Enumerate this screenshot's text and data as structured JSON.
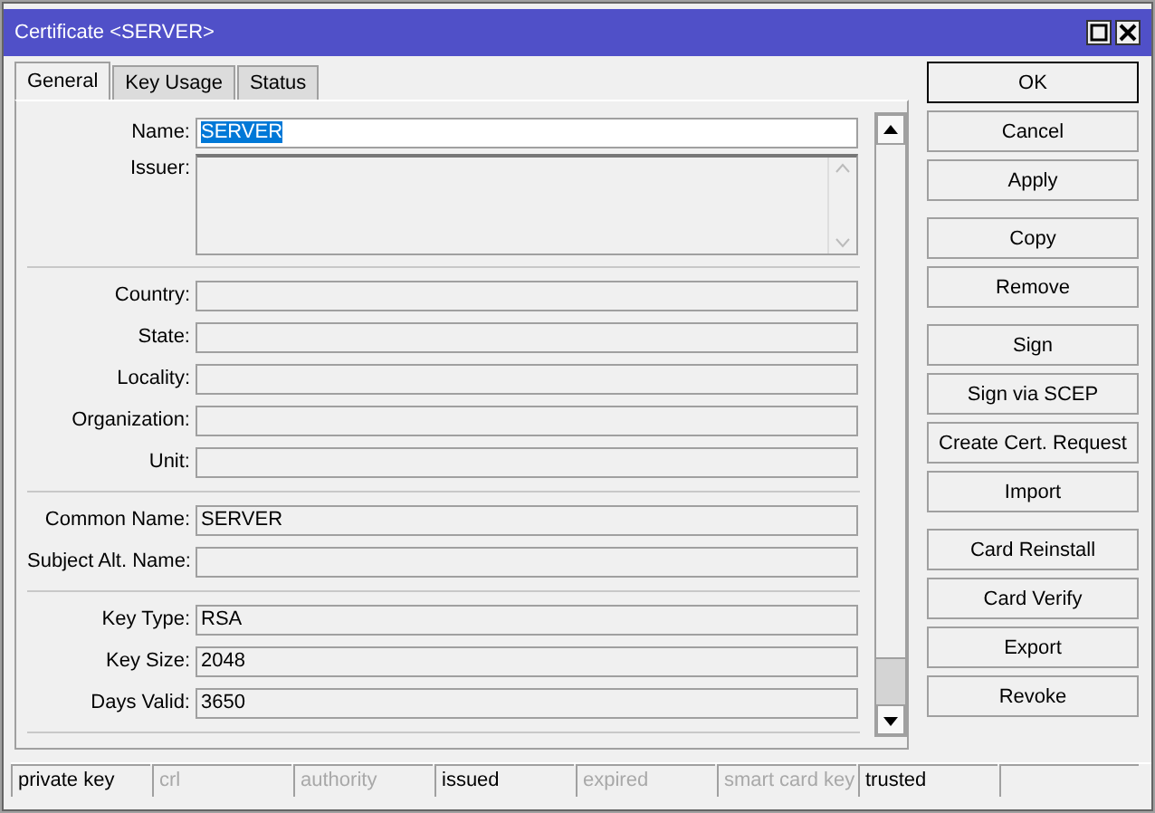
{
  "window": {
    "title": "Certificate <SERVER>"
  },
  "tabs": [
    {
      "label": "General",
      "selected": true
    },
    {
      "label": "Key Usage",
      "selected": false
    },
    {
      "label": "Status",
      "selected": false
    }
  ],
  "sections": [
    [
      {
        "label": "Name:",
        "kind": "input",
        "value": "SERVER",
        "highlighted": true
      },
      {
        "label": "Issuer:",
        "kind": "textarea"
      }
    ],
    [
      {
        "label": "Country:",
        "kind": "readonly"
      },
      {
        "label": "State:",
        "kind": "readonly"
      },
      {
        "label": "Locality:",
        "kind": "readonly"
      },
      {
        "label": "Organization:",
        "kind": "readonly"
      },
      {
        "label": "Unit:",
        "kind": "readonly"
      }
    ],
    [
      {
        "label": "Common Name:",
        "kind": "readonly",
        "value": "SERVER"
      },
      {
        "label": "Subject Alt. Name:",
        "kind": "readonly"
      }
    ],
    [
      {
        "label": "Key Type:",
        "kind": "readonly",
        "value": "RSA"
      },
      {
        "label": "Key Size:",
        "kind": "readonly",
        "value": "2048"
      },
      {
        "label": "Days Valid:",
        "kind": "readonly",
        "value": "3650"
      }
    ]
  ],
  "button_groups": [
    [
      {
        "label": "OK",
        "default": true
      },
      {
        "label": "Cancel",
        "default": false
      },
      {
        "label": "Apply",
        "default": false
      }
    ],
    [
      {
        "label": "Copy",
        "default": false
      },
      {
        "label": "Remove",
        "default": false
      }
    ],
    [
      {
        "label": "Sign",
        "default": false
      },
      {
        "label": "Sign via SCEP",
        "default": false
      },
      {
        "label": "Create Cert. Request",
        "default": false
      },
      {
        "label": "Import",
        "default": false
      }
    ],
    [
      {
        "label": "Card Reinstall",
        "default": false
      },
      {
        "label": "Card Verify",
        "default": false
      },
      {
        "label": "Export",
        "default": false
      },
      {
        "label": "Revoke",
        "default": false
      }
    ]
  ],
  "status_bar": [
    {
      "label": "private key",
      "active": true
    },
    {
      "label": "crl",
      "active": false
    },
    {
      "label": "authority",
      "active": false
    },
    {
      "label": "issued",
      "active": true
    },
    {
      "label": "expired",
      "active": false
    },
    {
      "label": "smart card key",
      "active": false
    },
    {
      "label": "trusted",
      "active": true
    }
  ]
}
